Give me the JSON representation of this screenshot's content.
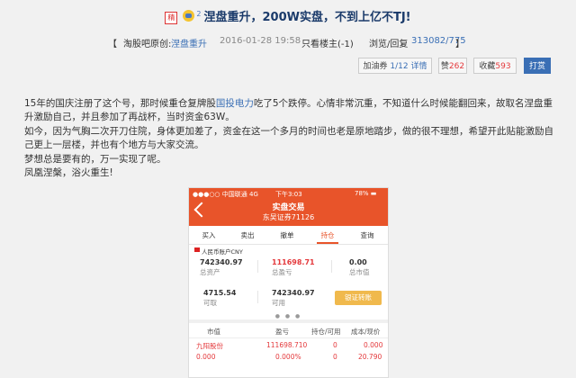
{
  "header": {
    "tag_icon": "精",
    "badge_icon": "user-level-badge-icon",
    "badge_level": "2",
    "title": "涅盘重升，200W实盘，不到上亿不TJ!"
  },
  "meta": {
    "bracket_open": "【",
    "source_prefix": "淘股吧原创:",
    "author": "涅盘重升",
    "datetime": "2016-01-28 19:58",
    "only_author": "只看楼主(-1)",
    "views_label": "浏览/回复",
    "views_value": "313082/775",
    "bracket_close": "】"
  },
  "actions": {
    "coupon_label": "加油券",
    "coupon_value": "1/12",
    "details": "详情",
    "like_label": "赞",
    "like_count": "262",
    "collect_label": "收藏",
    "collect_count": "593",
    "reward": "打赏"
  },
  "post": {
    "p1_a": "15年的国庆注册了这个号，那时候重仓复牌股",
    "p1_link": "国投电力",
    "p1_b": "吃了5个跌停。心情非常沉重，不知道什么时候能翻回来，故取名涅盘重升激励自己，并且参加了再战杯，当时资金63W。",
    "p2": "如今，因为气胸二次开刀住院，身体更加差了，资金在这一个多月的时间也老是原地踏步，做的很不理想，希望开此贴能激励自己更上一层楼，并也有个地方与大家交流。",
    "p3": "梦想总是要有的，万一实现了呢。",
    "p4": "凤凰涅槃，浴火重生!"
  },
  "phone": {
    "carrier": "●●●○○ 中国联通  4G",
    "time": "下午3:03",
    "battery": "78% ▬",
    "nav_title": "实盘交易",
    "nav_subtitle": "东吴证券71126",
    "tabs": [
      "买入",
      "卖出",
      "撤单",
      "持仓",
      "查询"
    ],
    "account": "人民币账户CNY",
    "total_assets_value": "742340.97",
    "total_assets_label": "总资产",
    "total_pnl_value": "111698.71",
    "total_pnl_label": "总盈亏",
    "total_mv_value": "0.00",
    "total_mv_label": "总市值",
    "withdrawable_value": "4715.54",
    "withdrawable_label": "可取",
    "available_value": "742340.97",
    "available_label": "可用",
    "transfer_button": "银证转账",
    "table_headers": [
      "市值",
      "盈亏",
      "持仓/可用",
      "成本/现价"
    ],
    "row": {
      "name": "九阳股份",
      "market_value": "0.000",
      "pnl": "111698.710",
      "pnl_pct": "0.000%",
      "position": "0",
      "available": "0",
      "cost": "0.000",
      "price": "20.790"
    }
  }
}
